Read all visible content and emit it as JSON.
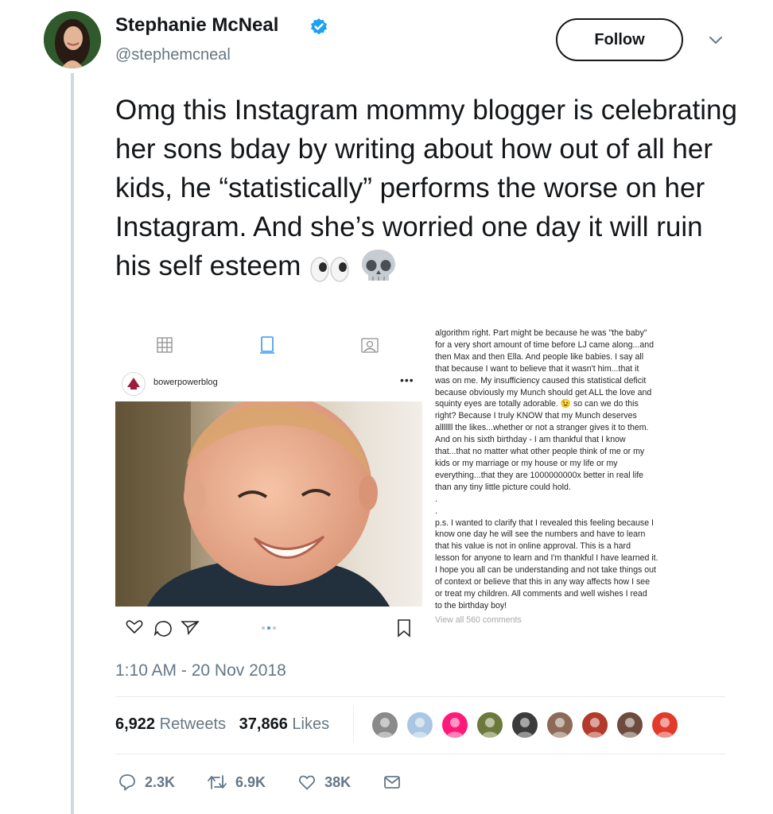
{
  "author": {
    "name": "Stephanie McNeal",
    "handle": "@stephemcneal",
    "verified": true,
    "avatar_icon": "profile-photo-woman"
  },
  "follow_label": "Follow",
  "tweet": {
    "text": "Omg this Instagram mommy blogger is celebrating her sons bday by writing about how out of all her kids, he “statistically” performs the worse on her Instagram. And she’s worried one day it will ruin his self esteem",
    "emojis": [
      "eyes-emoji",
      "skull-emoji"
    ]
  },
  "embed": {
    "instagram_username": "bowerpowerblog",
    "more_label": "•••",
    "caption_lines": [
      "algorithm right.  Part might be because he was \"the baby\"",
      "for a very short amount of time before LJ came along...and",
      "then Max and then Ella.  And people like babies.  I say all",
      "that because I want to believe that it wasn't him...that it",
      "was on me.  My insufficiency caused this statistical deficit",
      "because obviously my Munch should get ALL the love and",
      "squinty eyes are totally adorable. 😉 so can we do this",
      "right?  Because I truly KNOW that my Munch deserves",
      "alllllll the likes...whether or not a stranger gives it to them.",
      "And on his sixth birthday - I am thankful that I know",
      "that...that no matter what other people think of me or my",
      "kids or my marriage or my house or my life or my",
      "everything...that they are 1000000000x better in real life",
      "than any tiny little picture could hold.",
      ".",
      ".",
      "p.s.  I wanted to clarify that I revealed this feeling because I",
      "know one day he will see the numbers and have to learn",
      "that his value is not in online approval.  This is a hard",
      "lesson for anyone to learn and I'm thankful I have learned it.",
      "I hope you all can be understanding and not take things out",
      "of context or believe that this in any way affects how I see",
      "or treat my children.  All comments and well wishes I read",
      "to the birthday boy!"
    ],
    "view_comments": "View all 560 comments"
  },
  "timestamp": "1:10 AM - 20 Nov 2018",
  "stats": {
    "retweets_count": "6,922",
    "retweets_label": "Retweets",
    "likes_count": "37,866",
    "likes_label": "Likes"
  },
  "likers": [
    {
      "icon": "liker-avatar-1",
      "color": "#8a8a8a"
    },
    {
      "icon": "liker-avatar-2",
      "color": "#a9c7e3"
    },
    {
      "icon": "liker-avatar-3",
      "color": "#ff1a7a"
    },
    {
      "icon": "liker-avatar-4",
      "color": "#6b7a3a"
    },
    {
      "icon": "liker-avatar-5",
      "color": "#3b3b3b"
    },
    {
      "icon": "liker-avatar-6",
      "color": "#8c6a57"
    },
    {
      "icon": "liker-avatar-7",
      "color": "#b23b2b"
    },
    {
      "icon": "liker-avatar-8",
      "color": "#6d4b3d"
    },
    {
      "icon": "liker-avatar-9",
      "color": "#e23b2b"
    }
  ],
  "actions": {
    "reply_count": "2.3K",
    "retweet_count": "6.9K",
    "like_count": "38K"
  },
  "colors": {
    "verified": "#1da1f2",
    "secondary_text": "#657786",
    "divider": "#e6ecf0",
    "instagram_active_tab": "#3897f0"
  }
}
